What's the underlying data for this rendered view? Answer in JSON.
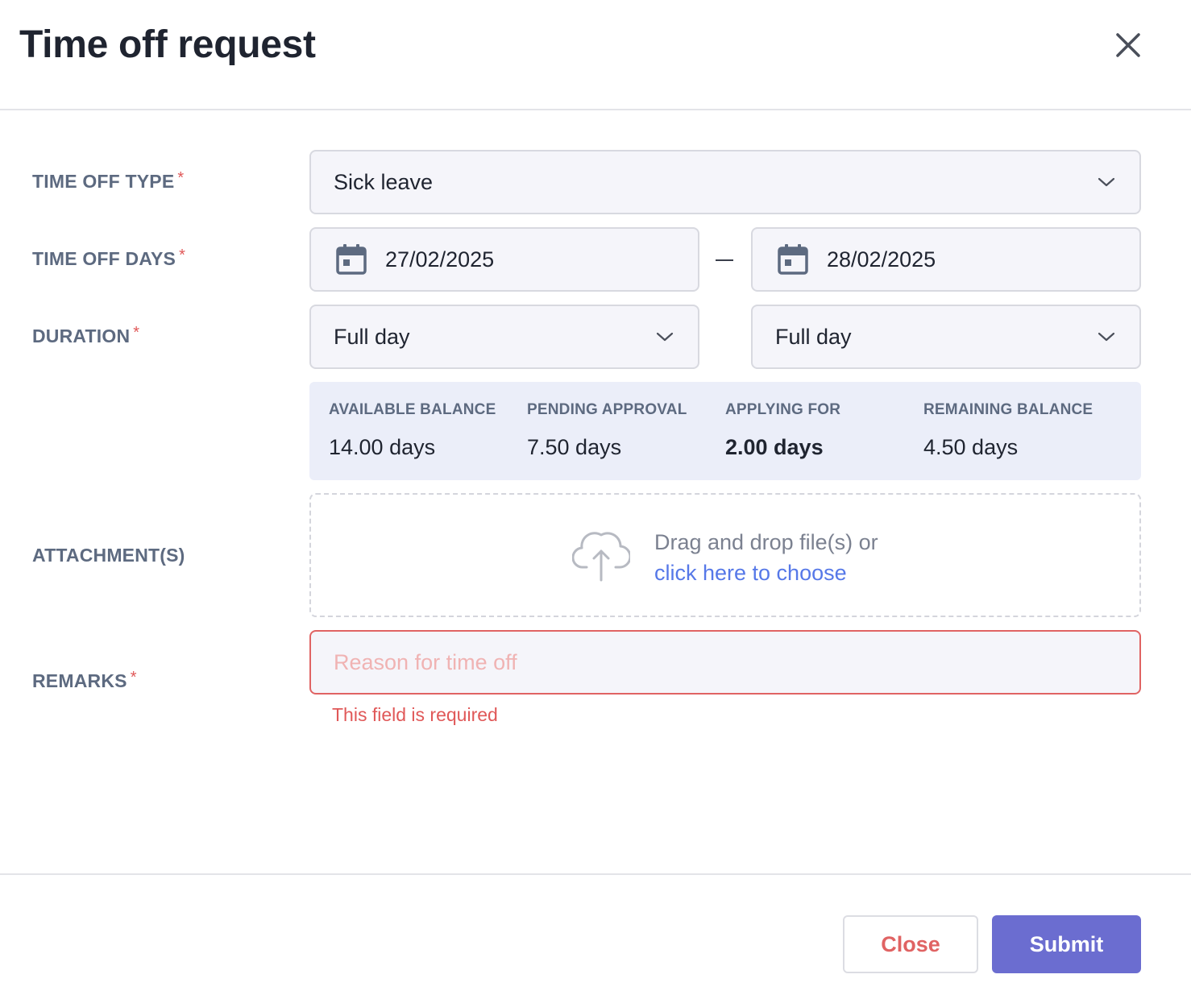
{
  "header": {
    "title": "Time off request",
    "close_icon": "close-icon"
  },
  "form": {
    "type_label": "TIME OFF TYPE",
    "days_label": "TIME OFF DAYS",
    "duration_label": "DURATION",
    "attachments_label": "ATTACHMENT(S)",
    "remarks_label": "REMARKS",
    "required_mark": "*",
    "type_value": "Sick leave",
    "start_date": "27/02/2025",
    "end_date": "28/02/2025",
    "start_duration": "Full day",
    "end_duration": "Full day",
    "remarks_placeholder": "Reason for time off",
    "remarks_value": "",
    "remarks_error": "This field is required"
  },
  "balance": {
    "available_label": "AVAILABLE BALANCE",
    "available_value": "14.00 days",
    "pending_label": "PENDING APPROVAL",
    "pending_value": "7.50 days",
    "applying_label": "APPLYING FOR",
    "applying_value": "2.00 days",
    "remaining_label": "REMAINING BALANCE",
    "remaining_value": "4.50 days"
  },
  "dropzone": {
    "text": "Drag and drop file(s) or",
    "link_text": "click here to choose",
    "icon": "cloud-upload-icon"
  },
  "footer": {
    "close_label": "Close",
    "submit_label": "Submit"
  },
  "colors": {
    "accent": "#6b6dd0",
    "error": "#e05858",
    "link": "#5678e8",
    "balance_bg": "#ebeef9"
  }
}
